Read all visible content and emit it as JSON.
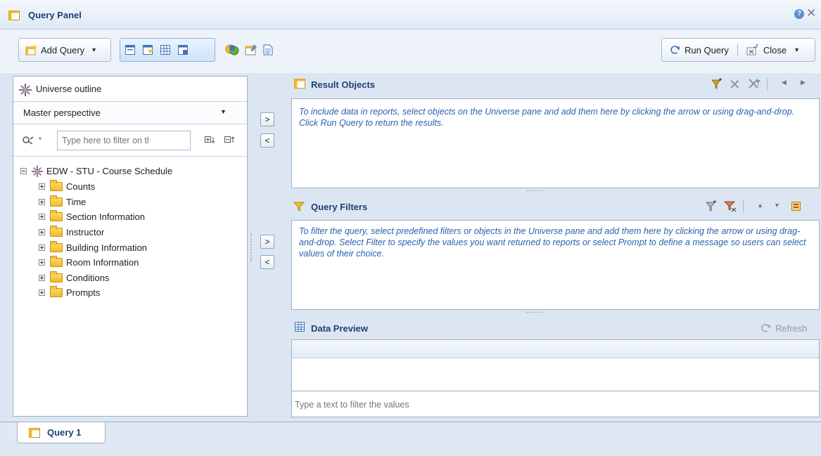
{
  "window": {
    "title": "Query Panel",
    "help_label": "?",
    "close_label": "✕"
  },
  "toolbar": {
    "add_query_label": "Add Query",
    "run_query_label": "Run Query",
    "close_label": "Close"
  },
  "universe": {
    "title": "Universe outline",
    "perspective": "Master perspective",
    "filter_placeholder": "Type here to filter on tl",
    "root_label": "EDW - STU - Course Schedule",
    "folders": [
      "Counts",
      "Time",
      "Section Information",
      "Instructor",
      "Building Information",
      "Room Information",
      "Conditions",
      "Prompts"
    ]
  },
  "arrows": {
    "add": ">",
    "remove": "<"
  },
  "result_objects": {
    "title": "Result Objects",
    "hint": "To include data in reports, select objects on the Universe pane and add them here by clicking the arrow or using drag-and-drop. Click Run Query to return the results."
  },
  "query_filters": {
    "title": "Query Filters",
    "hint": "To filter the query, select predefined filters or objects in the Universe pane and add them here by clicking the arrow or using drag-and-drop. Select Filter to specify the values you want returned to reports or select Prompt to define a message so users can select values of their choice."
  },
  "data_preview": {
    "title": "Data Preview",
    "refresh_label": "Refresh",
    "filter_placeholder": "Type a text to filter the values"
  },
  "tabs": {
    "query_tab_label": "Query 1"
  }
}
